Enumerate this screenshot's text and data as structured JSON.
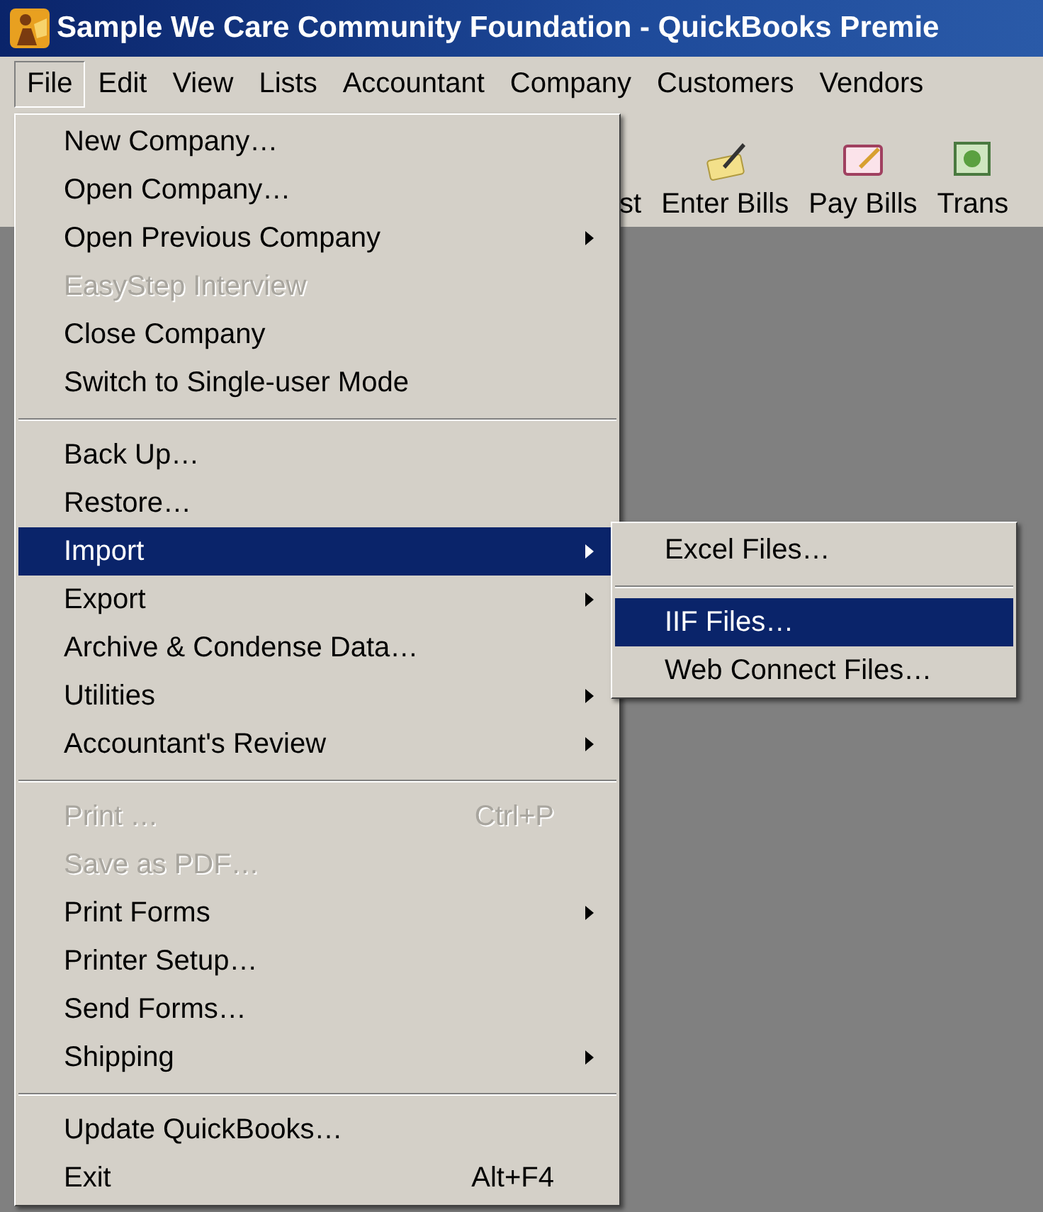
{
  "window": {
    "title": "Sample We Care Community Foundation - QuickBooks Premie"
  },
  "menubar": [
    {
      "label": "File",
      "selected": true
    },
    {
      "label": "Edit",
      "selected": false
    },
    {
      "label": "View",
      "selected": false
    },
    {
      "label": "Lists",
      "selected": false
    },
    {
      "label": "Accountant",
      "selected": false
    },
    {
      "label": "Company",
      "selected": false
    },
    {
      "label": "Customers",
      "selected": false
    },
    {
      "label": "Vendors",
      "selected": false
    }
  ],
  "toolbar": [
    {
      "label": "st",
      "kind": "text"
    },
    {
      "label": "Enter Bills",
      "kind": "enter-bills"
    },
    {
      "label": "Pay Bills",
      "kind": "pay-bills"
    },
    {
      "label": "Trans",
      "kind": "transfer"
    }
  ],
  "menu": {
    "items": [
      {
        "kind": "item",
        "label": "New Company…",
        "disabled": false,
        "selected": false,
        "submenu": false
      },
      {
        "kind": "item",
        "label": "Open Company…",
        "disabled": false,
        "selected": false,
        "submenu": false
      },
      {
        "kind": "item",
        "label": "Open Previous Company",
        "disabled": false,
        "selected": false,
        "submenu": true
      },
      {
        "kind": "item",
        "label": "EasyStep Interview",
        "disabled": true,
        "selected": false,
        "submenu": false
      },
      {
        "kind": "item",
        "label": "Close Company",
        "disabled": false,
        "selected": false,
        "submenu": false
      },
      {
        "kind": "item",
        "label": "Switch to Single-user Mode",
        "disabled": false,
        "selected": false,
        "submenu": false
      },
      {
        "kind": "separator"
      },
      {
        "kind": "item",
        "label": "Back Up…",
        "disabled": false,
        "selected": false,
        "submenu": false
      },
      {
        "kind": "item",
        "label": "Restore…",
        "disabled": false,
        "selected": false,
        "submenu": false
      },
      {
        "kind": "item",
        "label": "Import",
        "disabled": false,
        "selected": true,
        "submenu": true
      },
      {
        "kind": "item",
        "label": "Export",
        "disabled": false,
        "selected": false,
        "submenu": true
      },
      {
        "kind": "item",
        "label": "Archive & Condense Data…",
        "disabled": false,
        "selected": false,
        "submenu": false
      },
      {
        "kind": "item",
        "label": "Utilities",
        "disabled": false,
        "selected": false,
        "submenu": true
      },
      {
        "kind": "item",
        "label": "Accountant's Review",
        "disabled": false,
        "selected": false,
        "submenu": true
      },
      {
        "kind": "separator"
      },
      {
        "kind": "item",
        "label": "Print …",
        "shortcut": "Ctrl+P",
        "disabled": true,
        "selected": false,
        "submenu": false
      },
      {
        "kind": "item",
        "label": "Save as PDF…",
        "disabled": true,
        "selected": false,
        "submenu": false
      },
      {
        "kind": "item",
        "label": "Print Forms",
        "disabled": false,
        "selected": false,
        "submenu": true
      },
      {
        "kind": "item",
        "label": "Printer Setup…",
        "disabled": false,
        "selected": false,
        "submenu": false
      },
      {
        "kind": "item",
        "label": "Send Forms…",
        "disabled": false,
        "selected": false,
        "submenu": false
      },
      {
        "kind": "item",
        "label": "Shipping",
        "disabled": false,
        "selected": false,
        "submenu": true
      },
      {
        "kind": "separator"
      },
      {
        "kind": "item",
        "label": "Update QuickBooks…",
        "disabled": false,
        "selected": false,
        "submenu": false
      },
      {
        "kind": "item",
        "label": "Exit",
        "shortcut": "Alt+F4",
        "disabled": false,
        "selected": false,
        "submenu": false
      }
    ]
  },
  "submenu": {
    "items": [
      {
        "kind": "item",
        "label": "Excel Files…",
        "disabled": false,
        "selected": false,
        "submenu": false
      },
      {
        "kind": "separator"
      },
      {
        "kind": "item",
        "label": "IIF Files…",
        "disabled": false,
        "selected": true,
        "submenu": false
      },
      {
        "kind": "item",
        "label": "Web Connect Files…",
        "disabled": false,
        "selected": false,
        "submenu": false
      }
    ]
  }
}
